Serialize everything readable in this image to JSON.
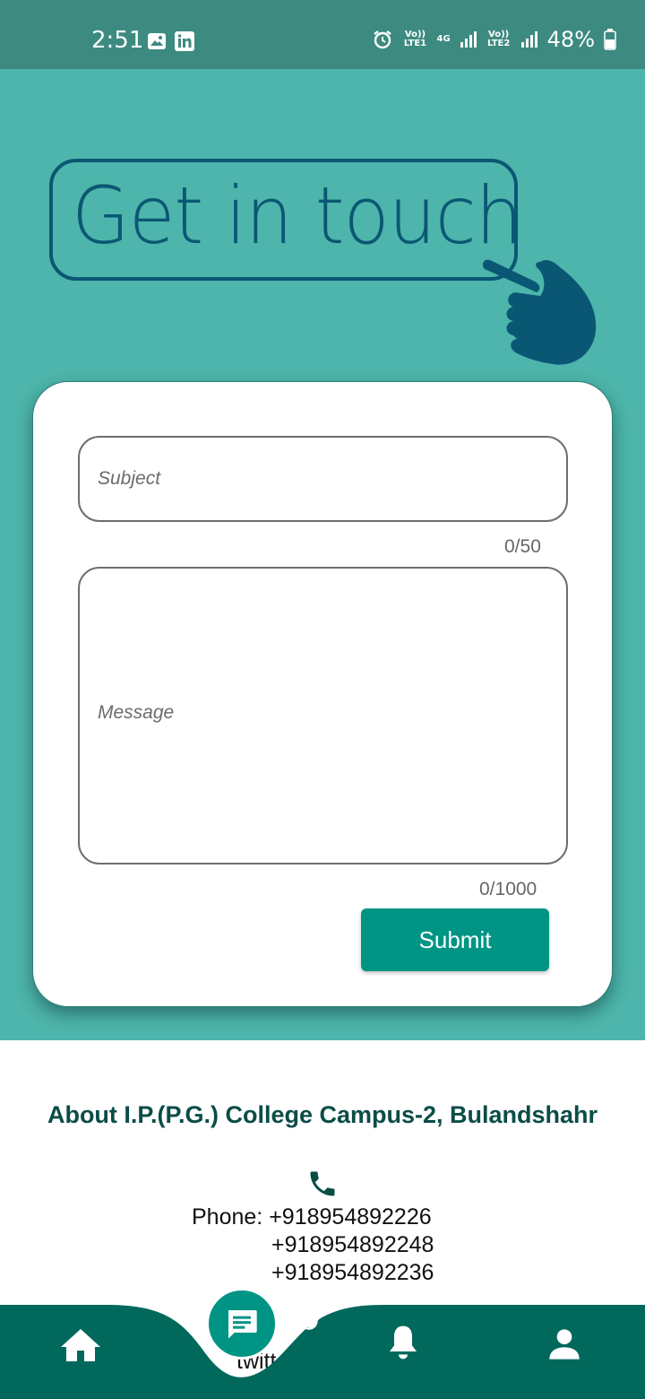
{
  "status_bar": {
    "time": "2:51",
    "net1": "Vo)) LTE1",
    "net_type": "4G",
    "net2": "Vo)) LTE2",
    "battery": "48%"
  },
  "hero": {
    "title": "Get in touch"
  },
  "form": {
    "subject_placeholder": "Subject",
    "subject_counter": "0/50",
    "message_placeholder": "Message",
    "message_counter": "0/1000",
    "submit_label": "Submit"
  },
  "about": {
    "title": "About I.P.(P.G.) College Campus-2, Bulandshahr",
    "phone_label": "Phone:",
    "phones": [
      "+918954892226",
      "+918954892248",
      "+918954892236"
    ],
    "twitter_label": "twitter"
  },
  "colors": {
    "status_bar": "#3d8a80",
    "hero_bg": "#4db5ab",
    "accent": "#009485",
    "nav_bg": "#00695c",
    "title_ink": "#0a5774"
  },
  "nav": {
    "items": [
      "home-icon",
      "chat-icon",
      "bell-icon",
      "person-icon"
    ]
  }
}
